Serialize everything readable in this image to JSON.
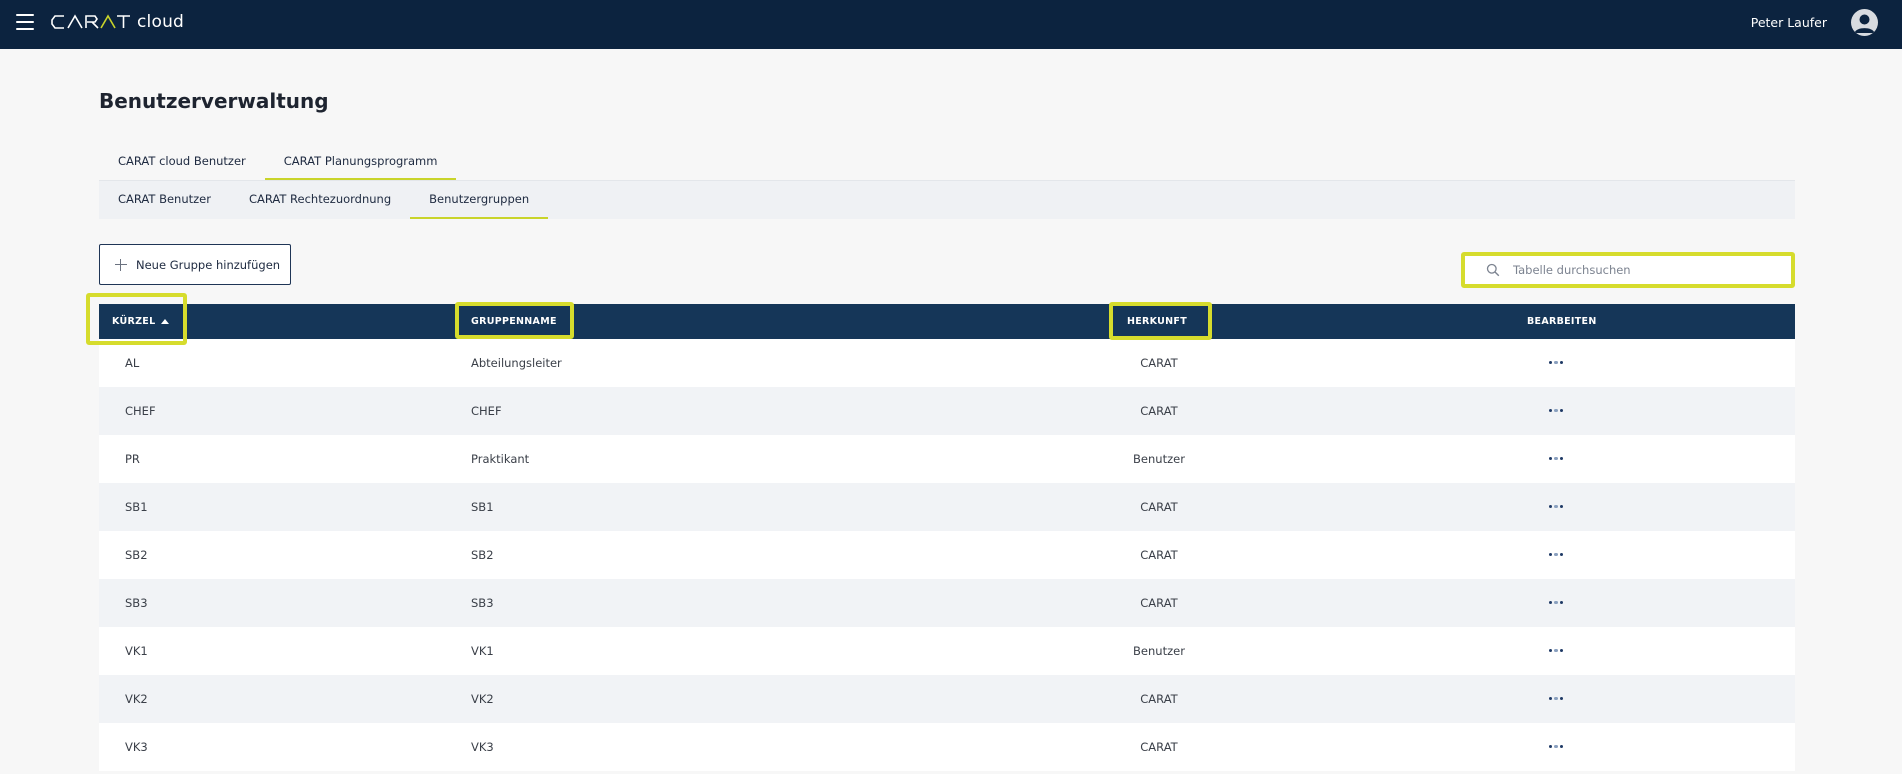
{
  "header": {
    "app_name": "CARAT",
    "app_suffix": "cloud",
    "user_name": "Peter Laufer",
    "menu_icon": "hamburger-menu-icon",
    "avatar_icon": "user-avatar-icon"
  },
  "page": {
    "title": "Benutzerverwaltung"
  },
  "tabs_primary": [
    {
      "label": "CARAT cloud Benutzer",
      "active": false
    },
    {
      "label": "CARAT Planungsprogramm",
      "active": true
    }
  ],
  "tabs_secondary": [
    {
      "label": "CARAT Benutzer",
      "active": false
    },
    {
      "label": "CARAT Rechtezuordnung",
      "active": false
    },
    {
      "label": "Benutzergruppen",
      "active": true
    }
  ],
  "toolbar": {
    "add_label": "Neue Gruppe hinzufügen",
    "add_icon": "plus-icon",
    "search_placeholder": "Tabelle durchsuchen",
    "search_value": "",
    "search_icon": "search-icon"
  },
  "table": {
    "columns": {
      "kuerzel": "KÜRZEL",
      "gruppenname": "GRUPPENNAME",
      "herkunft": "HERKUNFT",
      "bearbeiten": "BEARBEITEN"
    },
    "sort": {
      "column": "kuerzel",
      "direction": "asc"
    },
    "rows": [
      {
        "kuerzel": "AL",
        "gruppenname": "Abteilungsleiter",
        "herkunft": "CARAT"
      },
      {
        "kuerzel": "CHEF",
        "gruppenname": "CHEF",
        "herkunft": "CARAT"
      },
      {
        "kuerzel": "PR",
        "gruppenname": "Praktikant",
        "herkunft": "Benutzer"
      },
      {
        "kuerzel": "SB1",
        "gruppenname": "SB1",
        "herkunft": "CARAT"
      },
      {
        "kuerzel": "SB2",
        "gruppenname": "SB2",
        "herkunft": "CARAT"
      },
      {
        "kuerzel": "SB3",
        "gruppenname": "SB3",
        "herkunft": "CARAT"
      },
      {
        "kuerzel": "VK1",
        "gruppenname": "VK1",
        "herkunft": "Benutzer"
      },
      {
        "kuerzel": "VK2",
        "gruppenname": "VK2",
        "herkunft": "CARAT"
      },
      {
        "kuerzel": "VK3",
        "gruppenname": "VK3",
        "herkunft": "CARAT"
      }
    ]
  },
  "colors": {
    "header_bg": "#0c233f",
    "table_header_bg": "#153658",
    "accent": "#c9d42a",
    "highlight": "#d6dc2d",
    "more_dot_dark": "#1f3a66",
    "more_dot_light": "#8aa0bf"
  }
}
